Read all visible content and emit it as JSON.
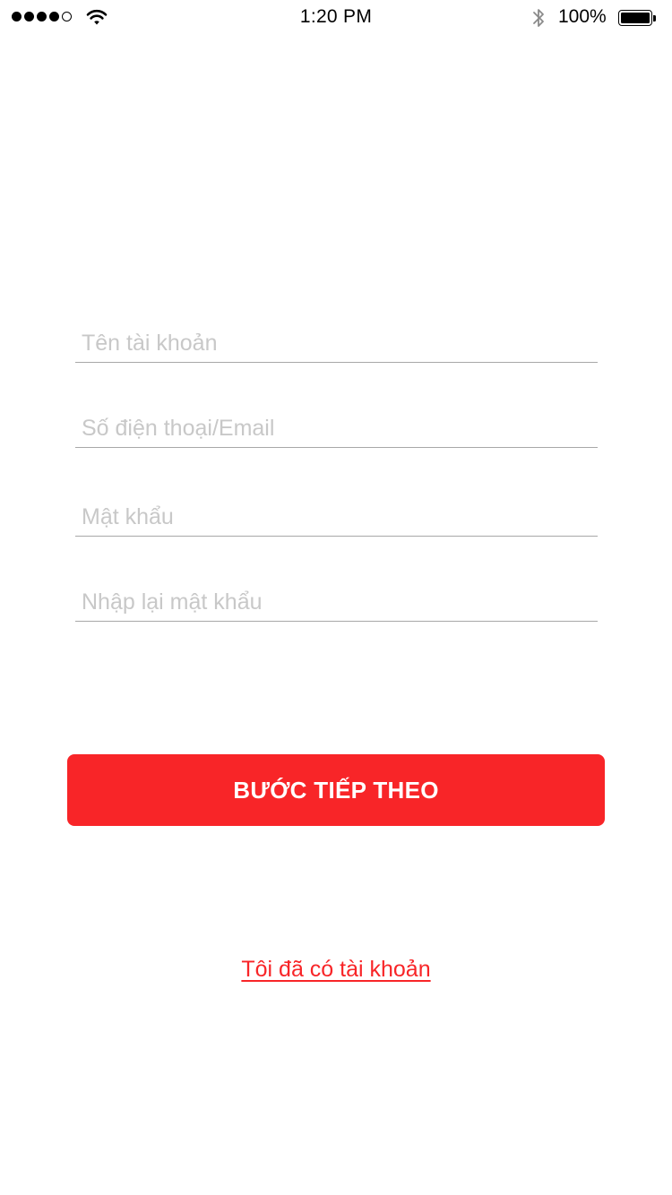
{
  "status_bar": {
    "time": "1:20 PM",
    "battery_percent": "100%",
    "signal_bars": 4,
    "signal_total": 5,
    "icons": [
      "signal-icon",
      "wifi-icon",
      "bluetooth-icon",
      "battery-icon"
    ]
  },
  "form": {
    "username": {
      "value": "",
      "placeholder": "Tên tài khoản"
    },
    "phone_email": {
      "value": "",
      "placeholder": "Số điện thoại/Email"
    },
    "password": {
      "value": "",
      "placeholder": "Mật khẩu"
    },
    "confirm_password": {
      "value": "",
      "placeholder": "Nhập lại mật khẩu"
    }
  },
  "actions": {
    "next_label": "BƯỚC TIẾP THEO",
    "login_link": "Tôi đã có tài khoản"
  },
  "colors": {
    "accent": "#f82528",
    "placeholder": "#c8c8c8",
    "divider": "#a8a8a8",
    "background": "#ffffff"
  }
}
